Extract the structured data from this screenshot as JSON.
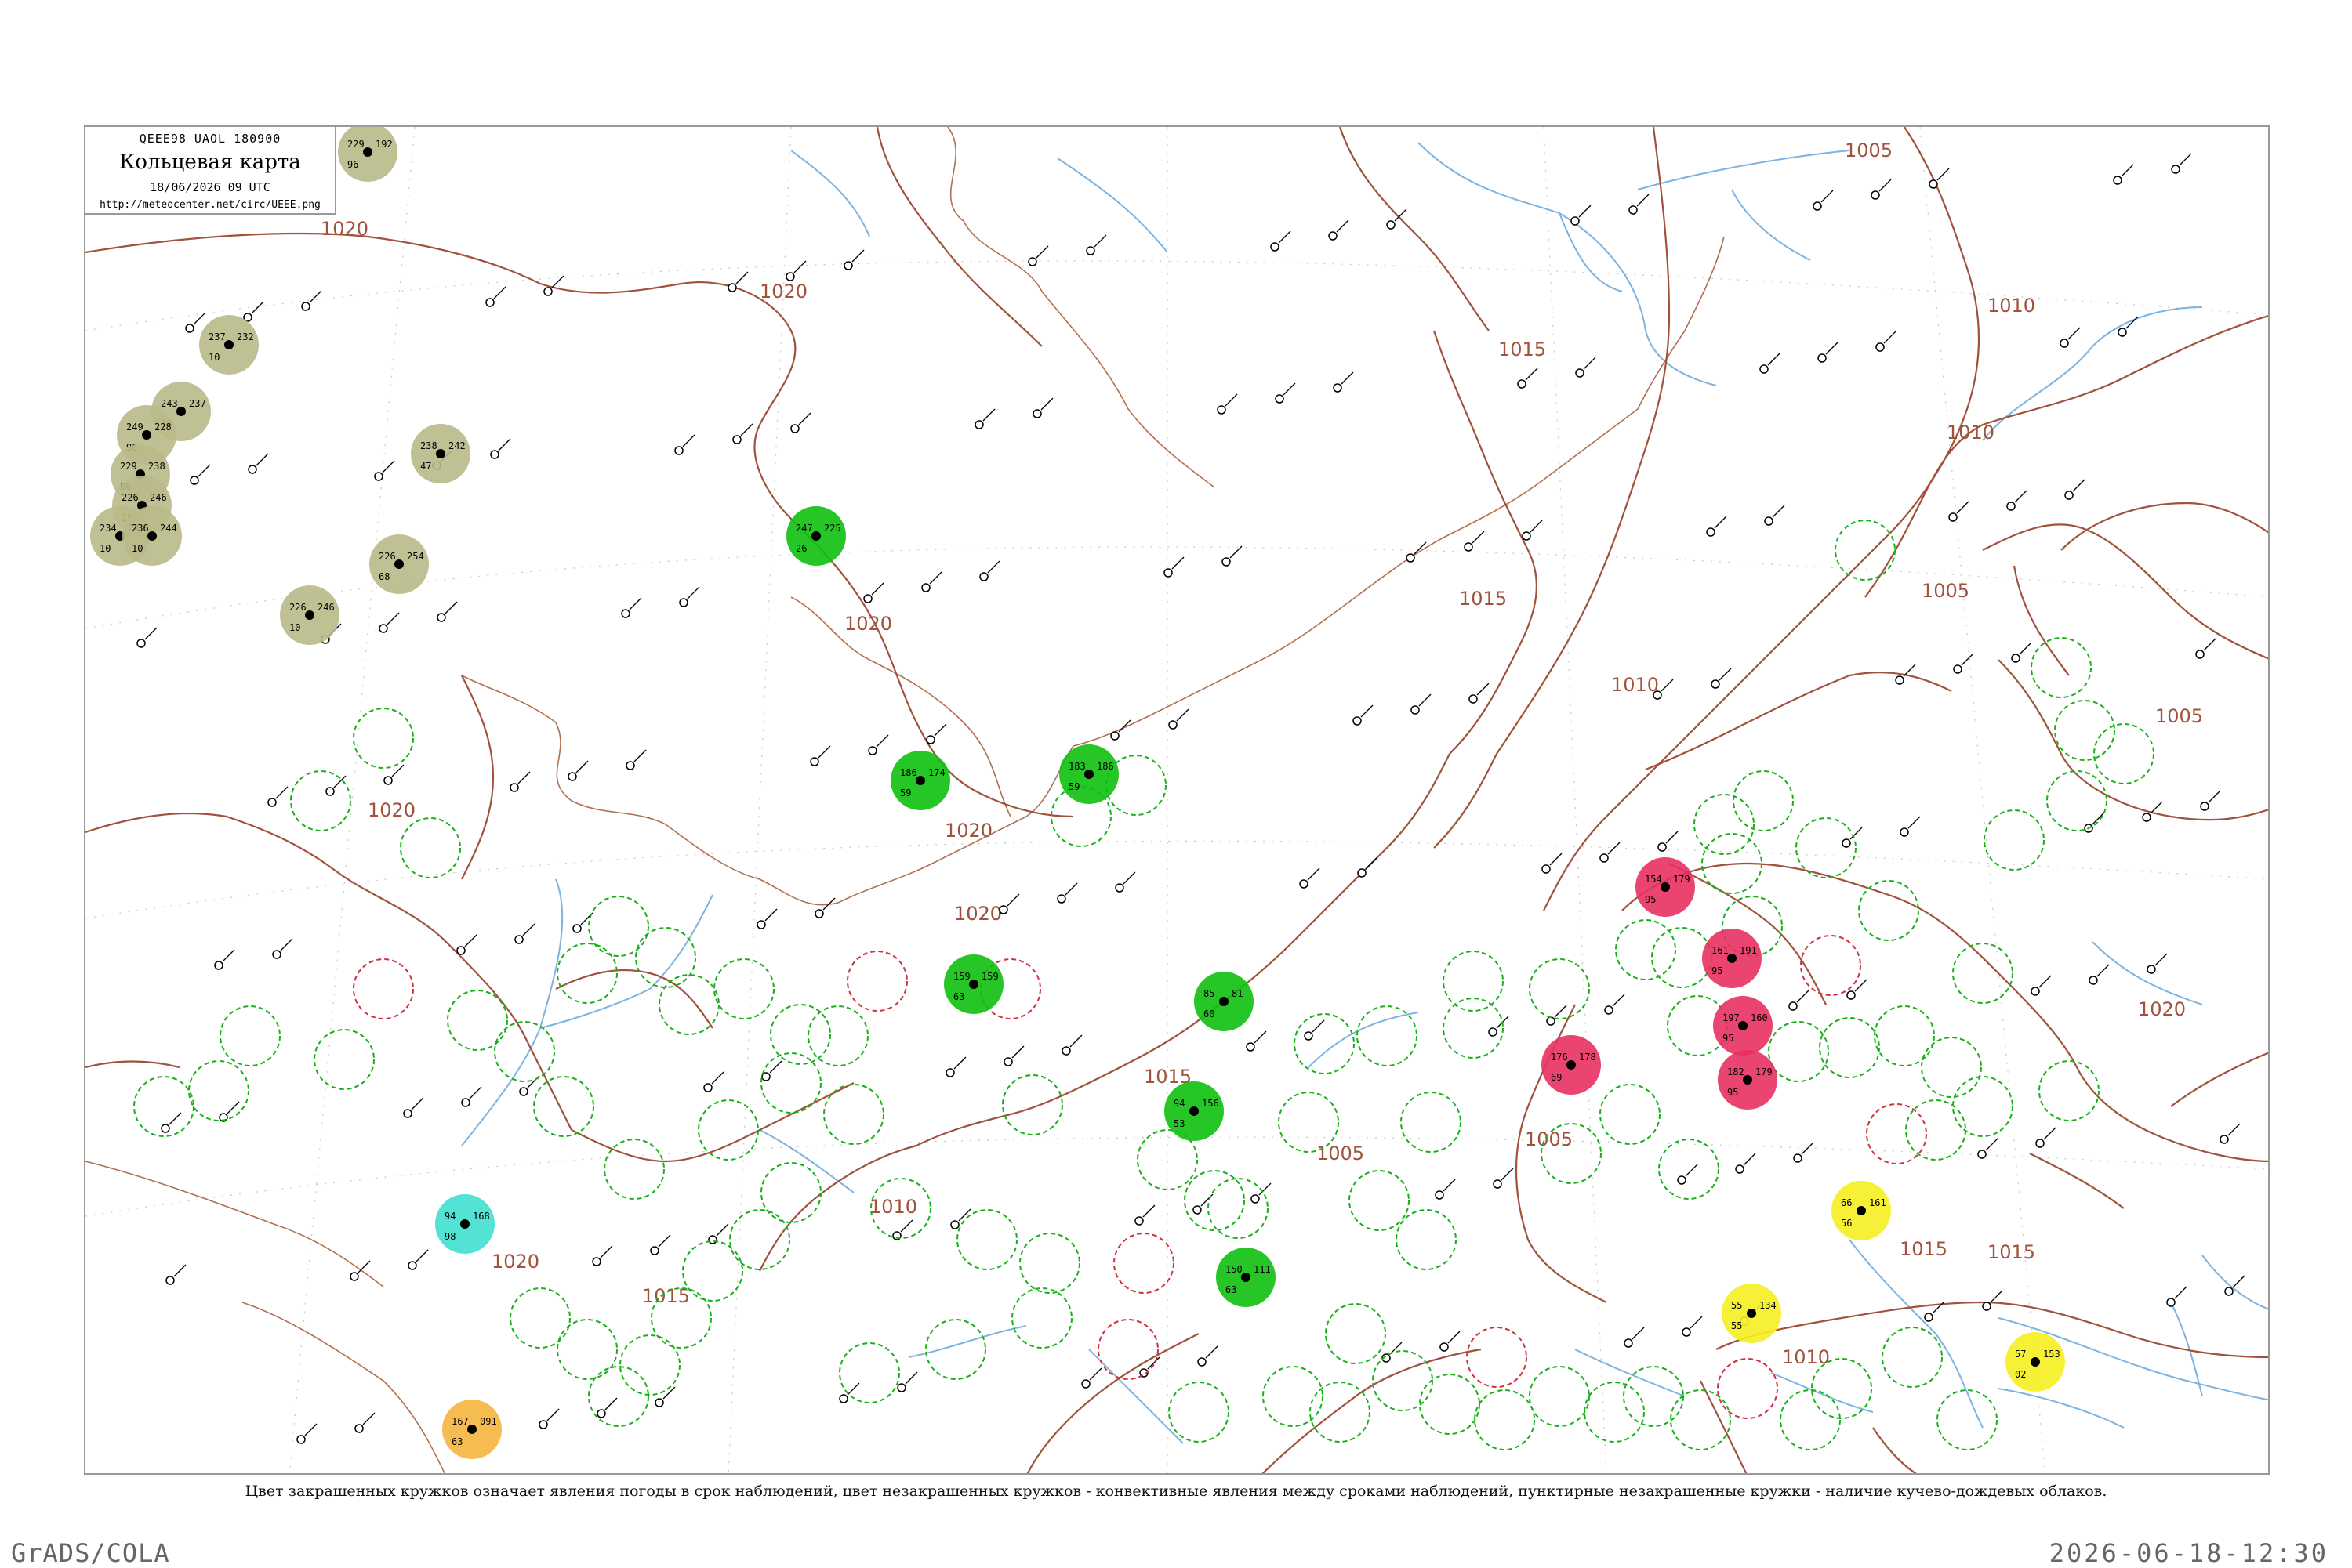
{
  "header": {
    "code": "QEEE98  UAOL  180900",
    "title": "Кольцевая карта",
    "datetime": "18/06/2026 09 UTC",
    "url": "http://meteocenter.net/circ/UEEE.png"
  },
  "caption": "Цвет закрашенных кружков означает явления погоды в срок наблюдений, цвет незакрашенных кружков - конвективные явления между сроками наблюдений, пунктирные незакрашенные кружки - наличие кучево-дождевых облаков.",
  "footer": {
    "left": "GrADS/COLA",
    "right": "2026-06-18-12:30"
  },
  "colors": {
    "isobar": "#a0523c",
    "river": "#7db3e0",
    "rain": "#10c010",
    "fog_haze": "#b9b98a",
    "snow_ice": "#f5b53f",
    "thunder": "#e83060",
    "sand_smoke": "#f5f020",
    "shower_cyan": "#40e0d0",
    "cb_dashed": "#18b018",
    "convective_red": "#d03040"
  },
  "isobar_labels": [
    "1020",
    "1020",
    "1020",
    "1020",
    "1020",
    "1020",
    "1015",
    "1015",
    "1015",
    "1015",
    "1015",
    "1010",
    "1010",
    "1010",
    "1010",
    "1005",
    "1005",
    "1005",
    "1005",
    "1005",
    "1010",
    "1015",
    "1020",
    "1020",
    "1020"
  ],
  "stations": [
    {
      "type": "fog",
      "t": "229",
      "p": "192",
      "d": "96"
    },
    {
      "type": "fog",
      "t": "237",
      "p": "232",
      "d": "10"
    },
    {
      "type": "fog",
      "t": "243",
      "p": "237",
      "d": "30"
    },
    {
      "type": "fog",
      "t": "249",
      "p": "228",
      "d": "96"
    },
    {
      "type": "fog",
      "t": "229",
      "p": "238",
      "d": "06"
    },
    {
      "type": "fog",
      "t": "226",
      "p": "246",
      "d": "10"
    },
    {
      "type": "fog",
      "t": "234",
      "p": "243",
      "d": "10"
    },
    {
      "type": "fog",
      "t": "236",
      "p": "244",
      "d": "10"
    },
    {
      "type": "fog",
      "t": "238",
      "p": "242",
      "d": "47"
    },
    {
      "type": "fog",
      "t": "226",
      "p": "254",
      "d": "68"
    },
    {
      "type": "fog",
      "t": "226",
      "p": "246",
      "d": "10"
    },
    {
      "type": "rain",
      "t": "247",
      "p": "225",
      "d": "26"
    },
    {
      "type": "rain",
      "t": "186",
      "p": "174",
      "d": "59"
    },
    {
      "type": "rain",
      "t": "183",
      "p": "186",
      "d": "59"
    },
    {
      "type": "rain",
      "t": "159",
      "p": "159",
      "d": "63"
    },
    {
      "type": "rain",
      "t": "85",
      "p": "81",
      "d": "60"
    },
    {
      "type": "rain",
      "t": "94",
      "p": "156",
      "d": "53"
    },
    {
      "type": "rain",
      "t": "150",
      "p": "111",
      "d": "63"
    },
    {
      "type": "thunder",
      "t": "176",
      "p": "178",
      "d": "69"
    },
    {
      "type": "thunder",
      "t": "154",
      "p": "179",
      "d": "95"
    },
    {
      "type": "thunder",
      "t": "161",
      "p": "191",
      "d": "95"
    },
    {
      "type": "thunder",
      "t": "182",
      "p": "179",
      "d": "95"
    },
    {
      "type": "thunder",
      "t": "197",
      "p": "160",
      "d": "95"
    },
    {
      "type": "snow",
      "t": "167",
      "p": "091",
      "d": "63"
    },
    {
      "type": "sand",
      "t": "66",
      "p": "161",
      "d": "56"
    },
    {
      "type": "sand",
      "t": "55",
      "p": "134",
      "d": "55"
    },
    {
      "type": "sand",
      "t": "57",
      "p": "153",
      "d": "02"
    },
    {
      "type": "shower",
      "t": "94",
      "p": "168",
      "d": "98"
    }
  ]
}
